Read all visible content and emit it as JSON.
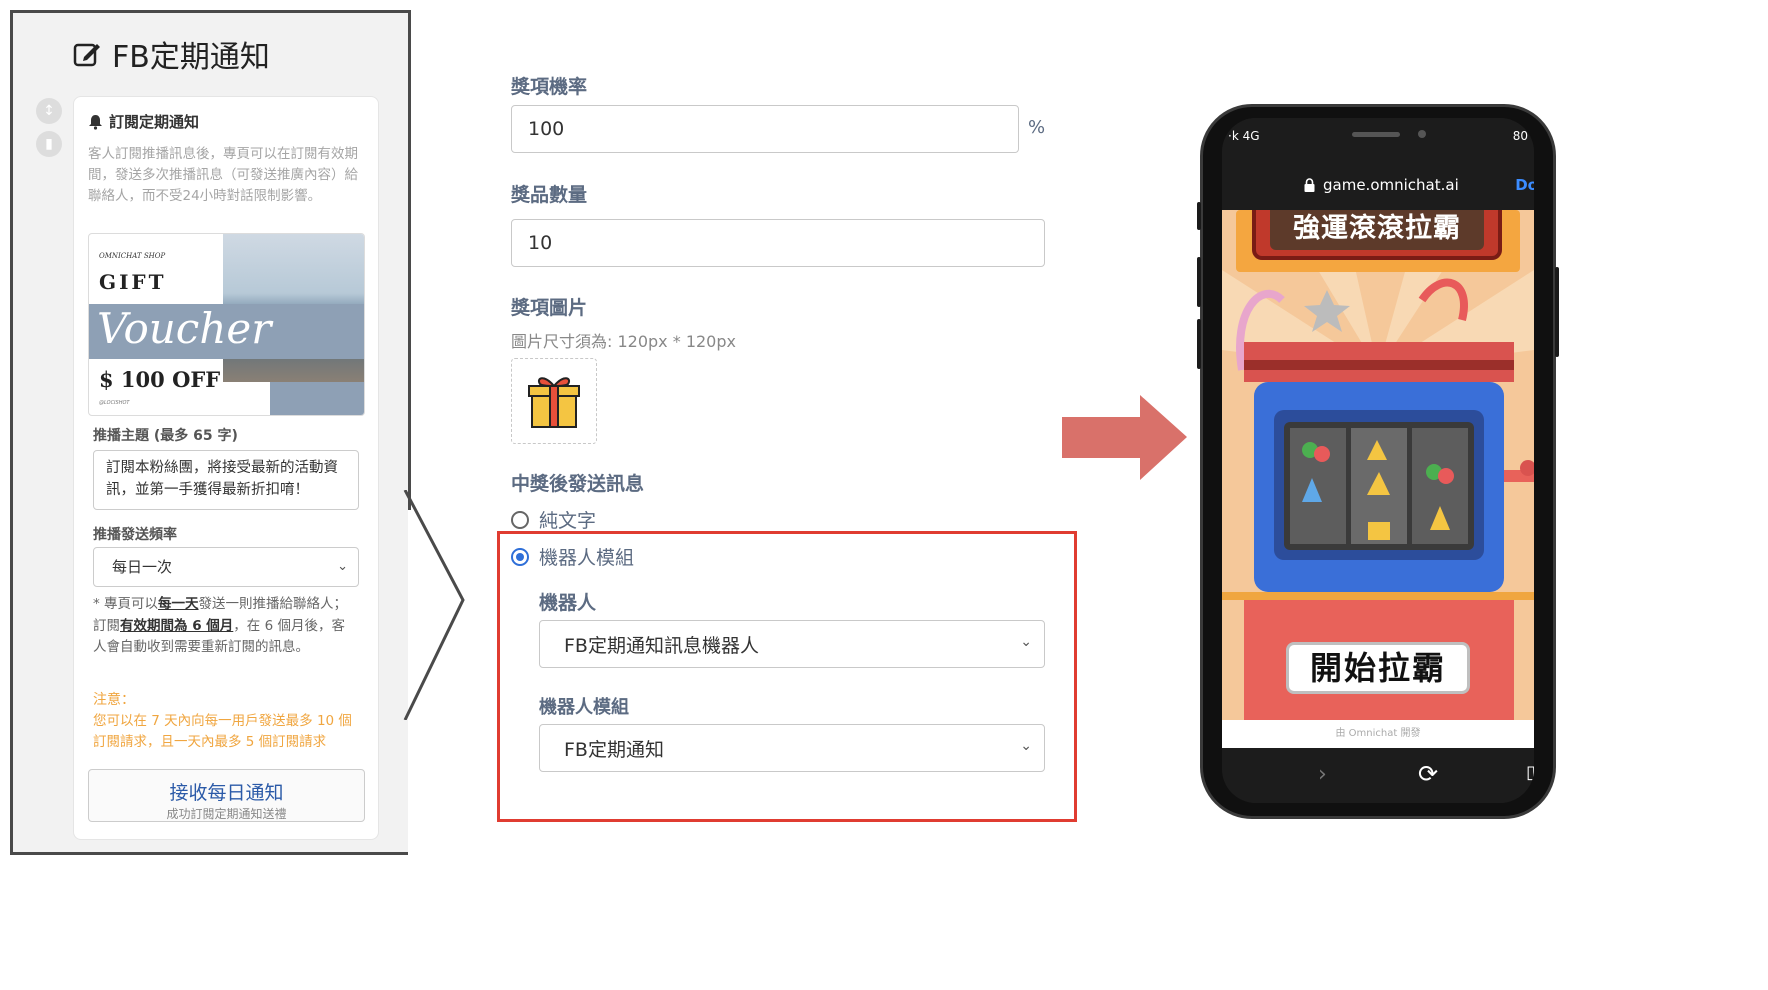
{
  "left_panel": {
    "title": "FB定期通知",
    "card_heading": "訂閱定期通知",
    "card_description": "客人訂閱推播訊息後，專頁可以在訂閱有效期間，發送多次推播訊息（可發送推廣內容）給聯絡人，而不受24小時對話限制影響。",
    "voucher": {
      "shop": "OMNICHAT SHOP",
      "gift": "GIFT",
      "script": "Voucher",
      "amount": "$ 100 OFF",
      "handle": "@LOCISHOT"
    },
    "topic_label": "推播主題 (最多 65 字)",
    "topic_value": "訂閱本粉絲團，將接受最新的活動資訊，並第一手獲得最新折扣唷！",
    "frequency_label": "推播發送頻率",
    "frequency_value": "每日一次",
    "frequency_note": {
      "p1": "* 專頁可以",
      "u1": "每一天",
      "p2": "發送一則推播給聯絡人；訂閱",
      "u2": "有效期間為 6 個月",
      "p3": "，在 6 個月後，客人會自動收到需要重新訂閱的訊息。"
    },
    "warning_title": "注意：",
    "warning_text": "您可以在 7 天內向每一用戶發送最多 10 個訂閱請求，且一天內最多 5 個訂閱請求",
    "subscribe_button": "接收每日通知",
    "subscribe_sub": "成功訂閱定期通知送禮"
  },
  "form": {
    "probability_label": "獎項機率",
    "probability_value": "100",
    "probability_unit": "%",
    "quantity_label": "獎品數量",
    "quantity_value": "10",
    "image_label": "獎項圖片",
    "image_hint": "圖片尺寸須為: 120px * 120px",
    "message_label": "中獎後發送訊息",
    "options": [
      {
        "label": "純文字",
        "selected": false
      },
      {
        "label": "機器人模組",
        "selected": true
      }
    ],
    "bot_label": "機器人",
    "bot_value": "FB定期通知訊息機器人",
    "module_label": "機器人模組",
    "module_value": "FB定期通知"
  },
  "phone": {
    "status_left": "·k 4G",
    "status_right": "80",
    "url": "game.omnichat.ai",
    "done": "Do",
    "game_title": "強運滾滾拉霸",
    "start_button": "開始拉霸",
    "powered_by": "由 Omnichat 開發"
  },
  "colors": {
    "accent_blue": "#2f6fd8",
    "highlight_red": "#e03c31",
    "arrow": "#d9716a",
    "warning": "#f0a640"
  }
}
